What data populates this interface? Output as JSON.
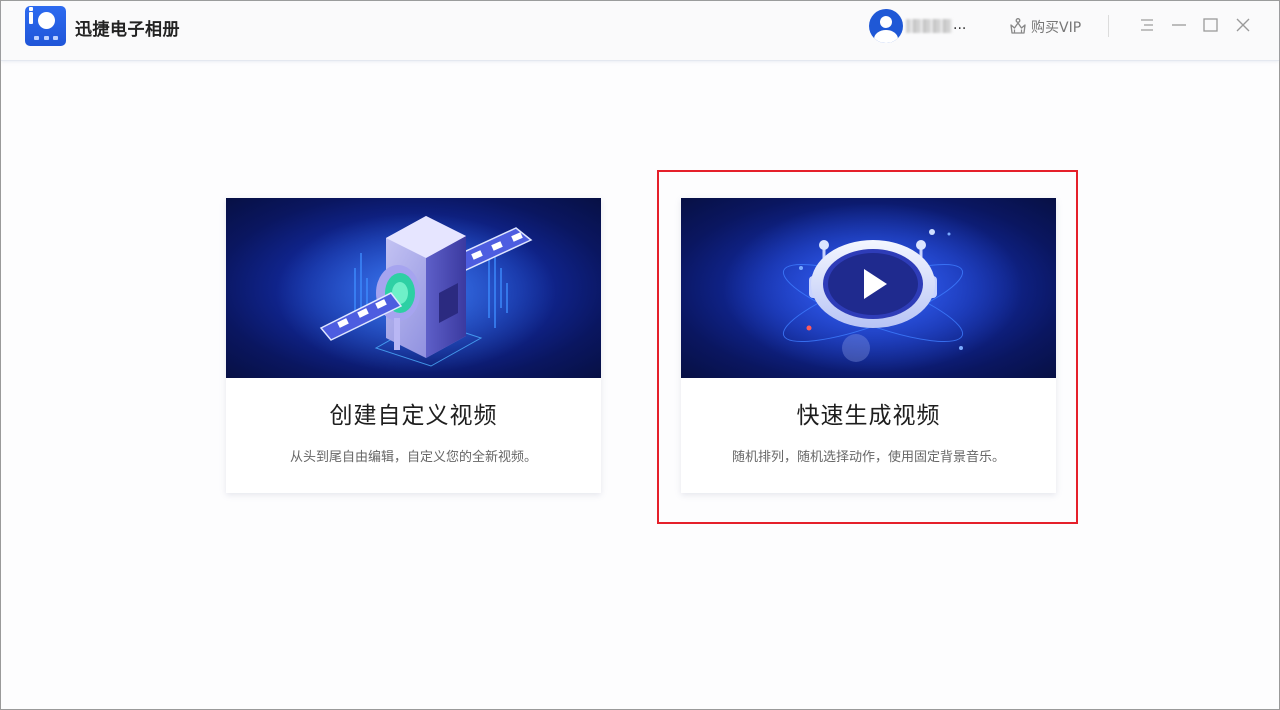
{
  "app": {
    "title": "迅捷电子相册"
  },
  "header": {
    "username_suffix": "...",
    "vip_label": "购买VIP"
  },
  "cards": [
    {
      "title": "创建自定义视频",
      "desc": "从头到尾自由编辑，自定义您的全新视频。",
      "image": "film-machine-illustration"
    },
    {
      "title": "快速生成视频",
      "desc": "随机排列，随机选择动作，使用固定背景音乐。",
      "image": "play-button-illustration"
    }
  ],
  "colors": {
    "accent": "#1f58d6",
    "highlight": "#e5202a",
    "banner_dark": "#0a1660"
  }
}
